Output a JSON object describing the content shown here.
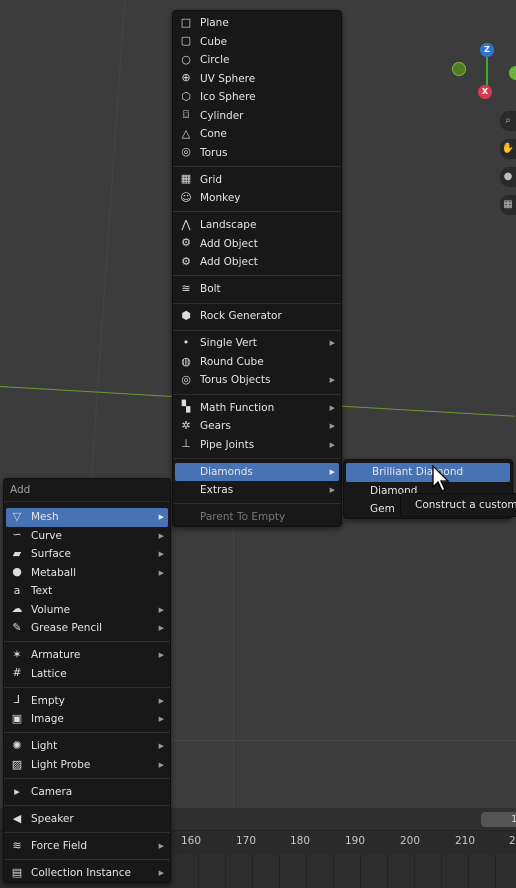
{
  "add_menu": {
    "title": "Add",
    "items": [
      {
        "label": "Mesh",
        "icon": "mesh-icon",
        "submenu": true,
        "active": true
      },
      {
        "label": "Curve",
        "icon": "curve-icon",
        "submenu": true
      },
      {
        "label": "Surface",
        "icon": "surface-icon",
        "submenu": true
      },
      {
        "label": "Metaball",
        "icon": "metaball-icon",
        "submenu": true
      },
      {
        "label": "Text",
        "icon": "text-icon",
        "submenu": false
      },
      {
        "label": "Volume",
        "icon": "volume-icon",
        "submenu": true
      },
      {
        "label": "Grease Pencil",
        "icon": "grease-pencil-icon",
        "submenu": true
      },
      {
        "label": "Armature",
        "icon": "armature-icon",
        "submenu": true
      },
      {
        "label": "Lattice",
        "icon": "lattice-icon",
        "submenu": false
      },
      {
        "label": "Empty",
        "icon": "empty-icon",
        "submenu": true
      },
      {
        "label": "Image",
        "icon": "image-icon",
        "submenu": true
      },
      {
        "label": "Light",
        "icon": "light-icon",
        "submenu": true
      },
      {
        "label": "Light Probe",
        "icon": "light-probe-icon",
        "submenu": true
      },
      {
        "label": "Camera",
        "icon": "camera-icon",
        "submenu": false
      },
      {
        "label": "Speaker",
        "icon": "speaker-icon",
        "submenu": false
      },
      {
        "label": "Force Field",
        "icon": "force-field-icon",
        "submenu": true
      },
      {
        "label": "Collection Instance",
        "icon": "collection-icon",
        "submenu": true
      }
    ]
  },
  "mesh_menu": {
    "items": [
      {
        "label": "Plane",
        "icon": "plane-icon"
      },
      {
        "label": "Cube",
        "icon": "cube-icon"
      },
      {
        "label": "Circle",
        "icon": "circle-icon"
      },
      {
        "label": "UV Sphere",
        "icon": "uv-sphere-icon"
      },
      {
        "label": "Ico Sphere",
        "icon": "ico-sphere-icon"
      },
      {
        "label": "Cylinder",
        "icon": "cylinder-icon"
      },
      {
        "label": "Cone",
        "icon": "cone-icon"
      },
      {
        "label": "Torus",
        "icon": "torus-icon"
      },
      {
        "label": "Grid",
        "icon": "grid-icon"
      },
      {
        "label": "Monkey",
        "icon": "monkey-icon"
      },
      {
        "label": "Landscape",
        "icon": "landscape-icon"
      },
      {
        "label": "Add Object",
        "icon": "plugin-icon"
      },
      {
        "label": "Add Object",
        "icon": "plugin-icon"
      },
      {
        "label": "Bolt",
        "icon": "bolt-icon"
      },
      {
        "label": "Rock Generator",
        "icon": "rock-icon"
      },
      {
        "label": "Single Vert",
        "icon": "vertex-icon",
        "submenu": true
      },
      {
        "label": "Round Cube",
        "icon": "round-cube-icon"
      },
      {
        "label": "Torus Objects",
        "icon": "torus-icon",
        "submenu": true
      },
      {
        "label": "Math Function",
        "icon": "math-function-icon",
        "submenu": true
      },
      {
        "label": "Gears",
        "icon": "gear-icon",
        "submenu": true
      },
      {
        "label": "Pipe Joints",
        "icon": "pipe-joint-icon",
        "submenu": true
      },
      {
        "label": "Diamonds",
        "submenu": true,
        "active": true
      },
      {
        "label": "Extras",
        "submenu": true
      },
      {
        "label": "Parent To Empty",
        "disabled": true
      }
    ]
  },
  "diamonds_menu": {
    "items": [
      {
        "label": "Brilliant Diamond",
        "active": true
      },
      {
        "label": "Diamond"
      },
      {
        "label": "Gem"
      }
    ]
  },
  "tooltip": "Construct a custom br",
  "gizmo": {
    "z_label": "Z",
    "x_label": "X"
  },
  "timeline": {
    "current_frame": "1",
    "ticks": [
      "160",
      "170",
      "180",
      "190",
      "200",
      "210",
      "2"
    ]
  },
  "colors": {
    "accent": "#4772b3",
    "menu_bg": "#181818",
    "viewport_bg": "#3c3c3c"
  }
}
